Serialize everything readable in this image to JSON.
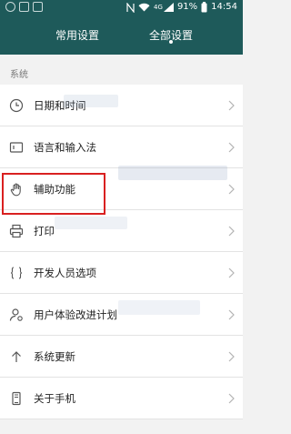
{
  "status_bar": {
    "network": "4G",
    "battery": "91%",
    "time": "14:54"
  },
  "tabs": [
    {
      "label": "常用设置",
      "active": false
    },
    {
      "label": "全部设置",
      "active": true
    }
  ],
  "section_title": "系统",
  "items": [
    {
      "label": "日期和时间",
      "icon": "clock-icon"
    },
    {
      "label": "语言和输入法",
      "icon": "keyboard-icon"
    },
    {
      "label": "辅助功能",
      "icon": "hand-icon",
      "highlighted": true
    },
    {
      "label": "打印",
      "icon": "printer-icon"
    },
    {
      "label": "开发人员选项",
      "icon": "braces-icon"
    },
    {
      "label": "用户体验改进计划",
      "icon": "user-icon"
    },
    {
      "label": "系统更新",
      "icon": "arrow-up-icon"
    },
    {
      "label": "关于手机",
      "icon": "phone-icon"
    }
  ],
  "colors": {
    "header": "#1e5a5a",
    "highlight_box": "#d92020"
  }
}
